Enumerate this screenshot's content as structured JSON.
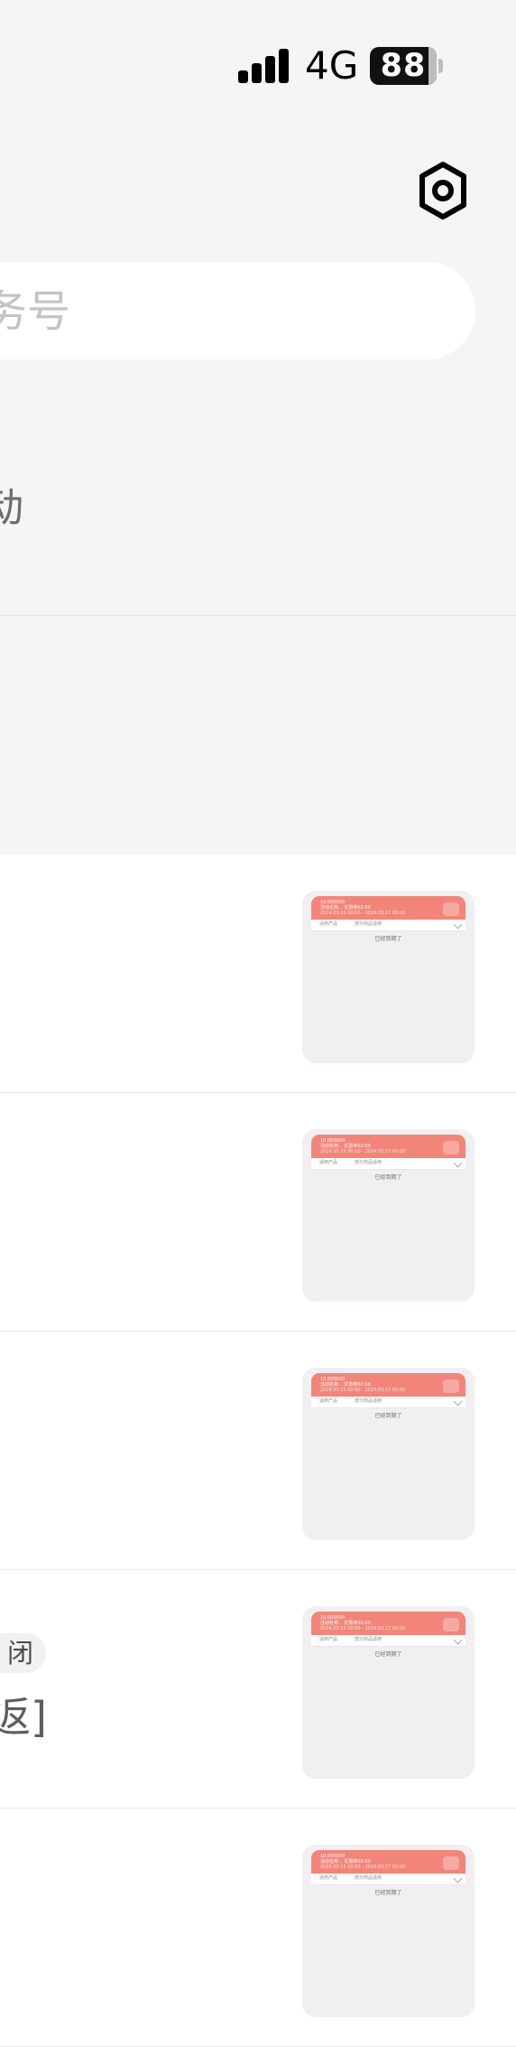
{
  "status_bar": {
    "network": "4G",
    "battery": "88",
    "icons": [
      "signal-icon",
      "battery-icon"
    ]
  },
  "header": {
    "settings_icon": "hexagon-settings-icon"
  },
  "search": {
    "placeholder": "务号"
  },
  "filter": {
    "label": "动"
  },
  "list": {
    "items": [
      {
        "thumbnail": {
          "header_line_1": "10.000000",
          "header_line_2": "活动名称... 优惠券02:00",
          "header_line_3": "2024.03.15 00:00 - 2024.03.17 00:00",
          "tab_1": "适用产品",
          "tab_2": "部分商品适用",
          "expired_text": "已经到期了"
        }
      },
      {
        "thumbnail": {
          "header_line_1": "10.000000",
          "header_line_2": "活动名称... 优惠券02:00",
          "header_line_3": "2024.03.15 00:00 - 2024.03.17 00:00",
          "tab_1": "适用产品",
          "tab_2": "部分商品适用",
          "expired_text": "已经到期了"
        }
      },
      {
        "thumbnail": {
          "header_line_1": "10.000000",
          "header_line_2": "活动名称... 优惠券02:00",
          "header_line_3": "2024.03.15 00:00 - 2024.03.17 00:00",
          "tab_1": "适用产品",
          "tab_2": "部分商品适用",
          "expired_text": "已经到期了"
        }
      },
      {
        "tag": "闭",
        "return_text": "返]",
        "thumbnail": {
          "header_line_1": "10.000000",
          "header_line_2": "活动名称... 优惠券02:00",
          "header_line_3": "2024.03.15 00:00 - 2024.03.17 00:00",
          "tab_1": "适用产品",
          "tab_2": "部分商品适用",
          "expired_text": "已经到期了"
        }
      },
      {
        "thumbnail": {
          "header_line_1": "10.000000",
          "header_line_2": "活动名称... 优惠券02:00",
          "header_line_3": "2024.03.15 00:00 - 2024.03.17 00:00",
          "tab_1": "适用产品",
          "tab_2": "部分商品适用",
          "expired_text": "已经到期了"
        }
      }
    ]
  },
  "colors": {
    "background": "#f5f5f5",
    "thumbnail_accent": "#f28579",
    "placeholder": "#c3c3c3"
  }
}
